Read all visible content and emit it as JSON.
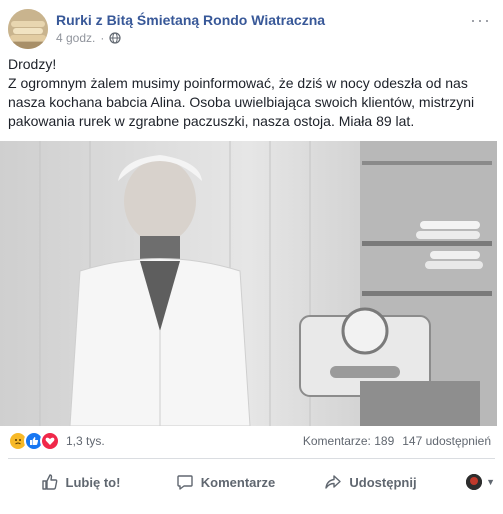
{
  "page": {
    "name": "Rurki z Bitą Śmietaną Rondo Wiatraczna",
    "time": "4 godz.",
    "more_label": "···"
  },
  "post": {
    "greeting": "Drodzy!",
    "body": "Z ogromnym żalem musimy poinformować, że dziś w nocy odeszła od nas nasza kochana babcia Alina. Osoba uwielbiająca swoich klientów, mistrzyni pakowania rurek w zgrabne paczuszki, nasza ostoja. Miała 89 lat."
  },
  "reactions": {
    "types": [
      "sad-icon",
      "like-icon",
      "love-icon"
    ],
    "count": "1,3 tys.",
    "comments": "Komentarze: 189",
    "shares": "147 udostępnień"
  },
  "actions": {
    "like": "Lubię to!",
    "comment": "Komentarze",
    "share": "Udostępnij"
  },
  "colors": {
    "link": "#385898",
    "muted": "#90949c",
    "action": "#606770",
    "like_blue": "#1877f2",
    "love_red": "#f0284a",
    "sad_yellow": "#f7b928"
  }
}
